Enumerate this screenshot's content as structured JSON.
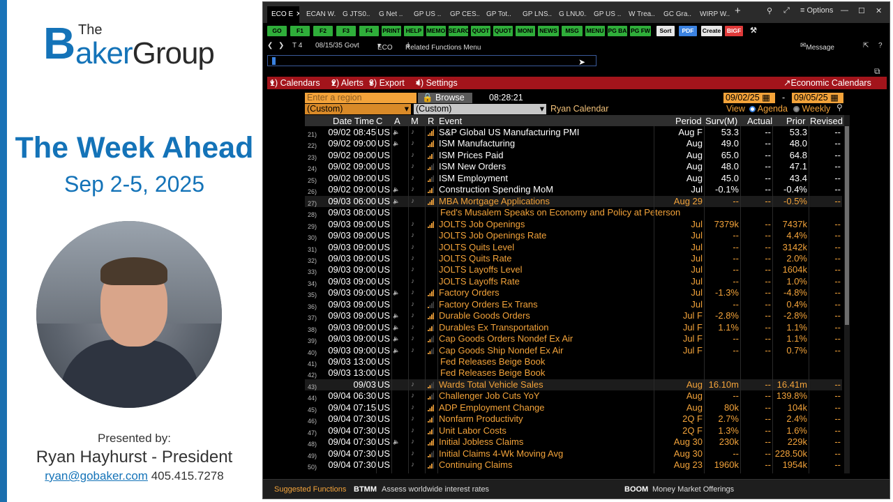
{
  "presentation": {
    "logo_the": "The",
    "logo_b": "B",
    "logo_baker": "aker",
    "logo_group": "Group",
    "title": "The Week Ahead",
    "dates": "Sep 2-5, 2025",
    "presented_by": "Presented by:",
    "presenter": "Ryan Hayhurst - President",
    "email": "ryan@gobaker.com",
    "phone": "405.415.7278"
  },
  "tabs": [
    {
      "label": "ECO E"
    },
    {
      "label": "ECAN W.."
    },
    {
      "label": "G JTS0.."
    },
    {
      "label": "G Net .."
    },
    {
      "label": "GP US .."
    },
    {
      "label": "GP CES.."
    },
    {
      "label": "GP Tot.."
    },
    {
      "label": "GP LNS.."
    },
    {
      "label": "G LNU0.."
    },
    {
      "label": "GP US .."
    },
    {
      "label": "W Trea.."
    },
    {
      "label": "GC Gra.."
    },
    {
      "label": "WIRP W.."
    }
  ],
  "window": {
    "options_label": "Options",
    "new_tab": "+"
  },
  "function_keys": [
    "GO",
    "F1",
    "F2",
    "F3",
    "F4",
    "PRINT",
    "HELP",
    "MEMO",
    "SEARC",
    "QUOT",
    "QUOT",
    "MONI",
    "NEWS",
    "MSG",
    "MENU",
    "PG BA",
    "PG FW",
    "Sort",
    "PDF",
    "Create",
    "BIGF"
  ],
  "nav": {
    "page_indicator": "T 4",
    "source": "08/15/35 Govt",
    "mnemonic": "ECO",
    "related": "Related Functions Menu",
    "message": "Message"
  },
  "menu": {
    "calendars": "1) Calendars",
    "alerts": "2) Alerts",
    "export": "3) Export",
    "settings": "4) Settings",
    "economic_calendars": "Economic Calendars"
  },
  "filters": {
    "region_placeholder": "Enter a region",
    "browse": "Browse",
    "time": "08:28:21",
    "date_from": "09/02/25",
    "date_sep": "-",
    "date_to": "09/05/25",
    "custom1": "(Custom)",
    "custom2": "(Custom)",
    "calendar_name": "Ryan Calendar",
    "view_label": "View",
    "agenda_label": "Agenda",
    "weekly_label": "Weekly"
  },
  "columns": {
    "datetime": "Date Time",
    "c": "C",
    "a": "A",
    "m": "M",
    "r": "R",
    "event": "Event",
    "period": "Period",
    "surv": "Surv(M)",
    "actual": "Actual",
    "prior": "Prior",
    "revised": "Revised"
  },
  "rows": [
    {
      "num": "21)",
      "dt": "09/02 08:45",
      "c": "US",
      "ev": "S&P Global US Manufacturing PMI",
      "per": "Aug F",
      "surv": "53.3",
      "act": "--",
      "pri": "53.3",
      "rev": "--",
      "orange": false,
      "a": true,
      "m": true,
      "r": 4
    },
    {
      "num": "22)",
      "dt": "09/02 09:00",
      "c": "US",
      "ev": "ISM Manufacturing",
      "per": "Aug",
      "surv": "49.0",
      "act": "--",
      "pri": "48.0",
      "rev": "--",
      "orange": false,
      "a": true,
      "m": true,
      "r": 4
    },
    {
      "num": "23)",
      "dt": "09/02 09:00",
      "c": "US",
      "ev": "ISM Prices Paid",
      "per": "Aug",
      "surv": "65.0",
      "act": "--",
      "pri": "64.8",
      "rev": "--",
      "orange": false,
      "a": false,
      "m": true,
      "r": 3
    },
    {
      "num": "24)",
      "dt": "09/02 09:00",
      "c": "US",
      "ev": "ISM New Orders",
      "per": "Aug",
      "surv": "48.0",
      "act": "--",
      "pri": "47.1",
      "rev": "--",
      "orange": false,
      "a": false,
      "m": true,
      "r": 2
    },
    {
      "num": "25)",
      "dt": "09/02 09:00",
      "c": "US",
      "ev": "ISM Employment",
      "per": "Aug",
      "surv": "45.0",
      "act": "--",
      "pri": "43.4",
      "rev": "--",
      "orange": false,
      "a": false,
      "m": true,
      "r": 2
    },
    {
      "num": "26)",
      "dt": "09/02 09:00",
      "c": "US",
      "ev": "Construction Spending MoM",
      "per": "Jul",
      "surv": "-0.1%",
      "act": "--",
      "pri": "-0.4%",
      "rev": "--",
      "orange": false,
      "a": true,
      "m": true,
      "r": 3
    },
    {
      "num": "27)",
      "dt": "09/03 06:00",
      "c": "US",
      "ev": "MBA Mortgage Applications",
      "per": "Aug 29",
      "surv": "--",
      "act": "--",
      "pri": "-0.5%",
      "rev": "--",
      "orange": true,
      "a": true,
      "m": true,
      "r": 4,
      "hl": true
    },
    {
      "num": "28)",
      "dt": "09/03 08:00",
      "c": "US",
      "ev": "Fed's Musalem Speaks on Economy and Policy at Peterson",
      "per": "",
      "surv": "",
      "act": "",
      "pri": "",
      "rev": "",
      "orange": true,
      "a": false,
      "m": false,
      "r": 0,
      "sub": true
    },
    {
      "num": "29)",
      "dt": "09/03 09:00",
      "c": "US",
      "ev": "JOLTS Job Openings",
      "per": "Jul",
      "surv": "7379k",
      "act": "--",
      "pri": "7437k",
      "rev": "--",
      "orange": true,
      "a": false,
      "m": true,
      "r": 4
    },
    {
      "num": "30)",
      "dt": "09/03 09:00",
      "c": "US",
      "ev": "JOLTS Job Openings Rate",
      "per": "Jul",
      "surv": "--",
      "act": "--",
      "pri": "4.4%",
      "rev": "--",
      "orange": true,
      "a": false,
      "m": true,
      "r": 0
    },
    {
      "num": "31)",
      "dt": "09/03 09:00",
      "c": "US",
      "ev": "JOLTS Quits Level",
      "per": "Jul",
      "surv": "--",
      "act": "--",
      "pri": "3142k",
      "rev": "--",
      "orange": true,
      "a": false,
      "m": true,
      "r": 0
    },
    {
      "num": "32)",
      "dt": "09/03 09:00",
      "c": "US",
      "ev": "JOLTS Quits Rate",
      "per": "Jul",
      "surv": "--",
      "act": "--",
      "pri": "2.0%",
      "rev": "--",
      "orange": true,
      "a": false,
      "m": true,
      "r": 0
    },
    {
      "num": "33)",
      "dt": "09/03 09:00",
      "c": "US",
      "ev": "JOLTS Layoffs Level",
      "per": "Jul",
      "surv": "--",
      "act": "--",
      "pri": "1604k",
      "rev": "--",
      "orange": true,
      "a": false,
      "m": true,
      "r": 0
    },
    {
      "num": "34)",
      "dt": "09/03 09:00",
      "c": "US",
      "ev": "JOLTS Layoffs Rate",
      "per": "Jul",
      "surv": "--",
      "act": "--",
      "pri": "1.0%",
      "rev": "--",
      "orange": true,
      "a": false,
      "m": true,
      "r": 0
    },
    {
      "num": "35)",
      "dt": "09/03 09:00",
      "c": "US",
      "ev": "Factory Orders",
      "per": "Jul",
      "surv": "-1.3%",
      "act": "--",
      "pri": "-4.8%",
      "rev": "--",
      "orange": true,
      "a": true,
      "m": true,
      "r": 4
    },
    {
      "num": "36)",
      "dt": "09/03 09:00",
      "c": "US",
      "ev": "Factory Orders Ex Trans",
      "per": "Jul",
      "surv": "--",
      "act": "--",
      "pri": "0.4%",
      "rev": "--",
      "orange": true,
      "a": false,
      "m": true,
      "r": 1
    },
    {
      "num": "37)",
      "dt": "09/03 09:00",
      "c": "US",
      "ev": "Durable Goods Orders",
      "per": "Jul F",
      "surv": "-2.8%",
      "act": "--",
      "pri": "-2.8%",
      "rev": "--",
      "orange": true,
      "a": true,
      "m": true,
      "r": 4
    },
    {
      "num": "38)",
      "dt": "09/03 09:00",
      "c": "US",
      "ev": "Durables Ex Transportation",
      "per": "Jul F",
      "surv": "1.1%",
      "act": "--",
      "pri": "1.1%",
      "rev": "--",
      "orange": true,
      "a": true,
      "m": true,
      "r": 3
    },
    {
      "num": "39)",
      "dt": "09/03 09:00",
      "c": "US",
      "ev": "Cap Goods Orders Nondef Ex Air",
      "per": "Jul F",
      "surv": "--",
      "act": "--",
      "pri": "1.1%",
      "rev": "--",
      "orange": true,
      "a": true,
      "m": true,
      "r": 2
    },
    {
      "num": "40)",
      "dt": "09/03 09:00",
      "c": "US",
      "ev": "Cap Goods Ship Nondef Ex Air",
      "per": "Jul F",
      "surv": "--",
      "act": "--",
      "pri": "0.7%",
      "rev": "--",
      "orange": true,
      "a": true,
      "m": true,
      "r": 2
    },
    {
      "num": "41)",
      "dt": "09/03 13:00",
      "c": "US",
      "ev": "Fed Releases Beige Book",
      "per": "",
      "surv": "",
      "act": "",
      "pri": "",
      "rev": "",
      "orange": true,
      "a": false,
      "m": false,
      "r": 0,
      "sub": true
    },
    {
      "num": "42)",
      "dt": "09/03 13:00",
      "c": "US",
      "ev": "Fed Releases Beige Book",
      "per": "",
      "surv": "",
      "act": "",
      "pri": "",
      "rev": "",
      "orange": true,
      "a": false,
      "m": false,
      "r": 0,
      "sub": true
    },
    {
      "num": "43)",
      "dt": "09/03",
      "c": "US",
      "ev": "Wards Total Vehicle Sales",
      "per": "Aug",
      "surv": "16.10m",
      "act": "--",
      "pri": "16.41m",
      "rev": "--",
      "orange": true,
      "a": false,
      "m": true,
      "r": 2,
      "hl": true
    },
    {
      "num": "44)",
      "dt": "09/04 06:30",
      "c": "US",
      "ev": "Challenger Job Cuts YoY",
      "per": "Aug",
      "surv": "--",
      "act": "--",
      "pri": "139.8%",
      "rev": "--",
      "orange": true,
      "a": false,
      "m": true,
      "r": 2
    },
    {
      "num": "45)",
      "dt": "09/04 07:15",
      "c": "US",
      "ev": "ADP Employment Change",
      "per": "Aug",
      "surv": "80k",
      "act": "--",
      "pri": "104k",
      "rev": "--",
      "orange": true,
      "a": false,
      "m": true,
      "r": 4
    },
    {
      "num": "46)",
      "dt": "09/04 07:30",
      "c": "US",
      "ev": "Nonfarm Productivity",
      "per": "2Q F",
      "surv": "2.7%",
      "act": "--",
      "pri": "2.4%",
      "rev": "--",
      "orange": true,
      "a": false,
      "m": true,
      "r": 3
    },
    {
      "num": "47)",
      "dt": "09/04 07:30",
      "c": "US",
      "ev": "Unit Labor Costs",
      "per": "2Q F",
      "surv": "1.3%",
      "act": "--",
      "pri": "1.6%",
      "rev": "--",
      "orange": true,
      "a": false,
      "m": true,
      "r": 3
    },
    {
      "num": "48)",
      "dt": "09/04 07:30",
      "c": "US",
      "ev": "Initial Jobless Claims",
      "per": "Aug 30",
      "surv": "230k",
      "act": "--",
      "pri": "229k",
      "rev": "--",
      "orange": true,
      "a": true,
      "m": true,
      "r": 4
    },
    {
      "num": "49)",
      "dt": "09/04 07:30",
      "c": "US",
      "ev": "Initial Claims 4-Wk Moving Avg",
      "per": "Aug 30",
      "surv": "--",
      "act": "--",
      "pri": "228.50k",
      "rev": "--",
      "orange": true,
      "a": false,
      "m": true,
      "r": 2
    },
    {
      "num": "50)",
      "dt": "09/04 07:30",
      "c": "US",
      "ev": "Continuing Claims",
      "per": "Aug 23",
      "surv": "1960k",
      "act": "--",
      "pri": "1954k",
      "rev": "--",
      "orange": true,
      "a": false,
      "m": true,
      "r": 3
    }
  ],
  "footer": {
    "suggested": "Suggested Functions",
    "f1_code": "BTMM",
    "f1_desc": "Assess worldwide interest rates",
    "f2_code": "BOOM",
    "f2_desc": "Money Market Offerings"
  }
}
